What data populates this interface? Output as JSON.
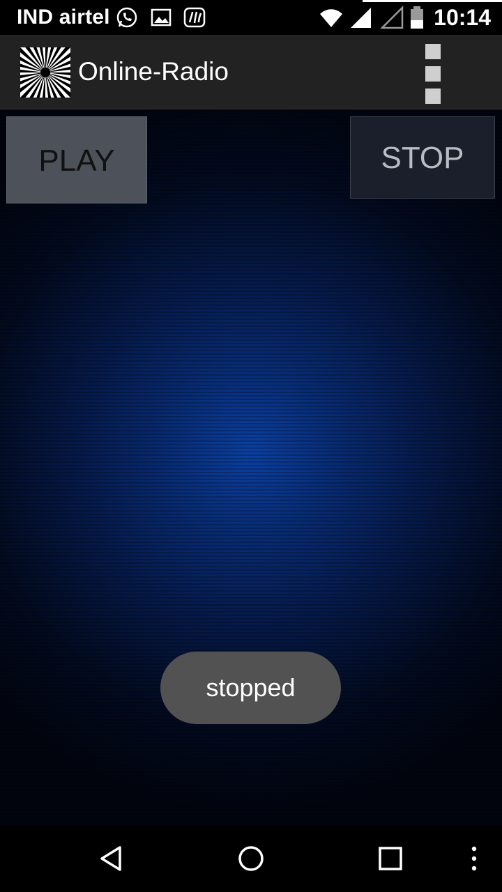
{
  "status_bar": {
    "carrier": "IND airtel",
    "time": "10:14",
    "icons": [
      "whatsapp-icon",
      "gallery-icon",
      "saavn-icon",
      "wifi-icon",
      "signal-icon",
      "signal-empty-icon",
      "battery-icon"
    ]
  },
  "app_bar": {
    "title": "Online-Radio",
    "logo_icon": "starburst-logo-icon",
    "menu_icon": "overflow-menu-icon"
  },
  "controls": {
    "play_label": "PLAY",
    "stop_label": "STOP"
  },
  "toast": {
    "message": "stopped"
  },
  "nav_bar": {
    "icons": [
      "back-icon",
      "home-icon",
      "recents-icon",
      "more-icon"
    ]
  },
  "colors": {
    "status_bar_bg": "#000000",
    "app_bar_bg": "#222222",
    "background_glow": "#0b3fa0",
    "toast_bg": "#525252",
    "play_button_bg": "#4d5159",
    "stop_button_bg": "#1a1f2b"
  }
}
